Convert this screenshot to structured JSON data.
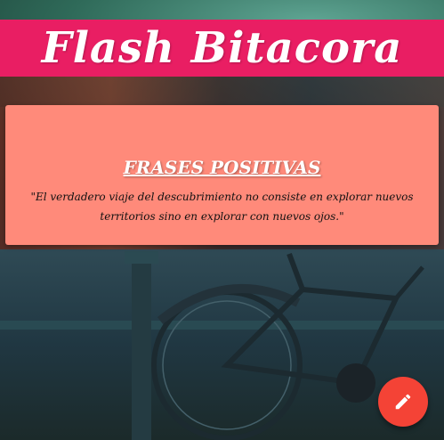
{
  "header": {
    "title": "Flash Bitacora"
  },
  "card": {
    "title": "FRASES POSITIVAS",
    "quote": "\"El verdadero viaje del descubrimiento no consiste en explorar nuevos territorios sino en explorar con nuevos ojos.\""
  },
  "fab": {
    "icon": "pencil-icon"
  },
  "colors": {
    "header_bg": "#e91e63",
    "card_bg": "#ff8a7a",
    "fab_bg": "#f44336"
  }
}
